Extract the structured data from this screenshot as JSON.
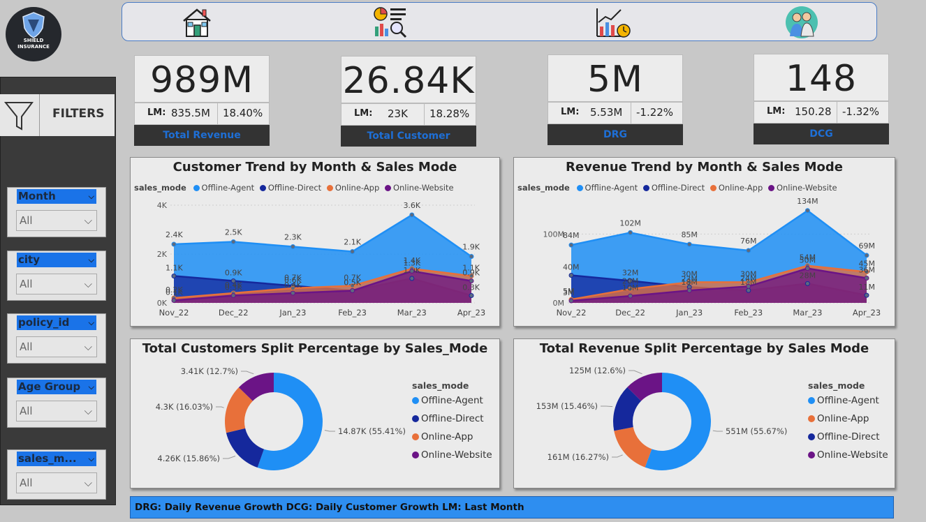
{
  "logo": {
    "line1": "SHIELD",
    "line2": "INSURANCE"
  },
  "nav": [
    {
      "icon": "home-icon"
    },
    {
      "icon": "report-analysis-icon"
    },
    {
      "icon": "growth-chart-icon"
    },
    {
      "icon": "people-icon"
    }
  ],
  "sidebar": {
    "title": "FILTERS",
    "slicers": [
      {
        "title": "Month",
        "value": "All"
      },
      {
        "title": "city",
        "value": "All"
      },
      {
        "title": "policy_id",
        "value": "All"
      },
      {
        "title": "Age Group",
        "value": "All"
      },
      {
        "title": "sales_m...",
        "value": "All"
      }
    ]
  },
  "kpis": [
    {
      "value": "989M",
      "lm_label": "LM:",
      "lm_value": "835.5M",
      "pct": "18.40%",
      "name": "Total Revenue"
    },
    {
      "value": "26.84K",
      "lm_label": "LM:",
      "lm_value": "23K",
      "pct": "18.28%",
      "name": "Total Customer"
    },
    {
      "value": "5M",
      "lm_label": "LM:",
      "lm_value": "5.53M",
      "pct": "-1.22%",
      "name": "DRG"
    },
    {
      "value": "148",
      "lm_label": "LM:",
      "lm_value": "150.28",
      "pct": "-1.32%",
      "name": "DCG"
    }
  ],
  "colors": {
    "offline_agent": "#1f8ff5",
    "offline_direct": "#15289c",
    "online_app": "#e8703a",
    "online_website": "#6b1486"
  },
  "chart_data": [
    {
      "type": "area",
      "title": "Customer Trend by Month & Sales Mode",
      "legend_title": "sales_mode",
      "categories": [
        "Nov_22",
        "Dec_22",
        "Jan_23",
        "Feb_23",
        "Mar_23",
        "Apr_23"
      ],
      "yticks": [
        "0K",
        "2K",
        "4K"
      ],
      "ylim": [
        0,
        4000
      ],
      "series": [
        {
          "name": "Offline-Agent",
          "values": [
            2400,
            2500,
            2300,
            2100,
            3600,
            1900
          ],
          "labels": [
            "2.4K",
            "2.5K",
            "2.3K",
            "2.1K",
            "3.6K",
            "1.9K"
          ]
        },
        {
          "name": "Offline-Direct",
          "values": [
            1100,
            900,
            700,
            500,
            1000,
            300
          ],
          "labels": [
            "1.1K",
            "0.9K",
            "0.7K",
            "0.5K",
            "1.0K",
            "0.3K"
          ]
        },
        {
          "name": "Online-App",
          "values": [
            200,
            400,
            600,
            700,
            1400,
            1100
          ],
          "labels": [
            "0.2K",
            "0.4K",
            "0.6K",
            "0.7K",
            "1.4K",
            "1.1K"
          ]
        },
        {
          "name": "Online-Website",
          "values": [
            100,
            300,
            400,
            500,
            1300,
            900
          ],
          "labels": [
            "0.1K",
            "0.3K",
            "0.4K",
            "0.5K",
            "1.3K",
            "0.9K"
          ]
        }
      ]
    },
    {
      "type": "area",
      "title": "Revenue Trend by Month & Sales Mode",
      "legend_title": "sales_mode",
      "categories": [
        "Nov_22",
        "Dec_22",
        "Jan_23",
        "Feb_23",
        "Mar_23",
        "Apr_23"
      ],
      "yticks": [
        "0M",
        "100M"
      ],
      "ylim": [
        0,
        150
      ],
      "series": [
        {
          "name": "Offline-Agent",
          "values": [
            84,
            102,
            85,
            76,
            134,
            69
          ],
          "labels": [
            "84M",
            "102M",
            "85M",
            "76M",
            "134M",
            "69M"
          ]
        },
        {
          "name": "Offline-Direct",
          "values": [
            40,
            32,
            23,
            18,
            28,
            11
          ],
          "labels": [
            "40M",
            "32M",
            "23M",
            "18M",
            "28M",
            "11M"
          ]
        },
        {
          "name": "Online-App",
          "values": [
            5,
            20,
            30,
            30,
            54,
            45
          ],
          "labels": [
            "5M",
            "20M",
            "30M",
            "30M",
            "54M",
            "45M"
          ]
        },
        {
          "name": "Online-Website",
          "values": [
            3,
            10,
            18,
            24,
            50,
            36
          ],
          "labels": [
            "3M",
            "10M",
            "18M",
            "24M",
            "50M",
            "36M"
          ]
        }
      ]
    },
    {
      "type": "pie",
      "title": "Total Customers Split Percentage by Sales_Mode",
      "legend_title": "sales_mode",
      "slices": [
        {
          "name": "Offline-Agent",
          "value": 55.41,
          "label": "14.87K (55.41%)"
        },
        {
          "name": "Offline-Direct",
          "value": 15.86,
          "label": "4.26K (15.86%)"
        },
        {
          "name": "Online-App",
          "value": 16.03,
          "label": "4.3K (16.03%)"
        },
        {
          "name": "Online-Website",
          "value": 12.7,
          "label": "3.41K (12.7%)"
        }
      ]
    },
    {
      "type": "pie",
      "title": "Total Revenue Split Percentage by Sales Mode",
      "legend_title": "sales_mode",
      "slices": [
        {
          "name": "Offline-Agent",
          "value": 55.67,
          "label": "551M (55.67%)"
        },
        {
          "name": "Online-App",
          "value": 16.27,
          "label": "161M (16.27%)"
        },
        {
          "name": "Offline-Direct",
          "value": 15.46,
          "label": "153M (15.46%)"
        },
        {
          "name": "Online-Website",
          "value": 12.6,
          "label": "125M (12.6%)"
        }
      ]
    }
  ],
  "footer": {
    "text": "DRG: Daily Revenue Growth  DCG: Daily Customer Growth  LM: Last Month"
  }
}
